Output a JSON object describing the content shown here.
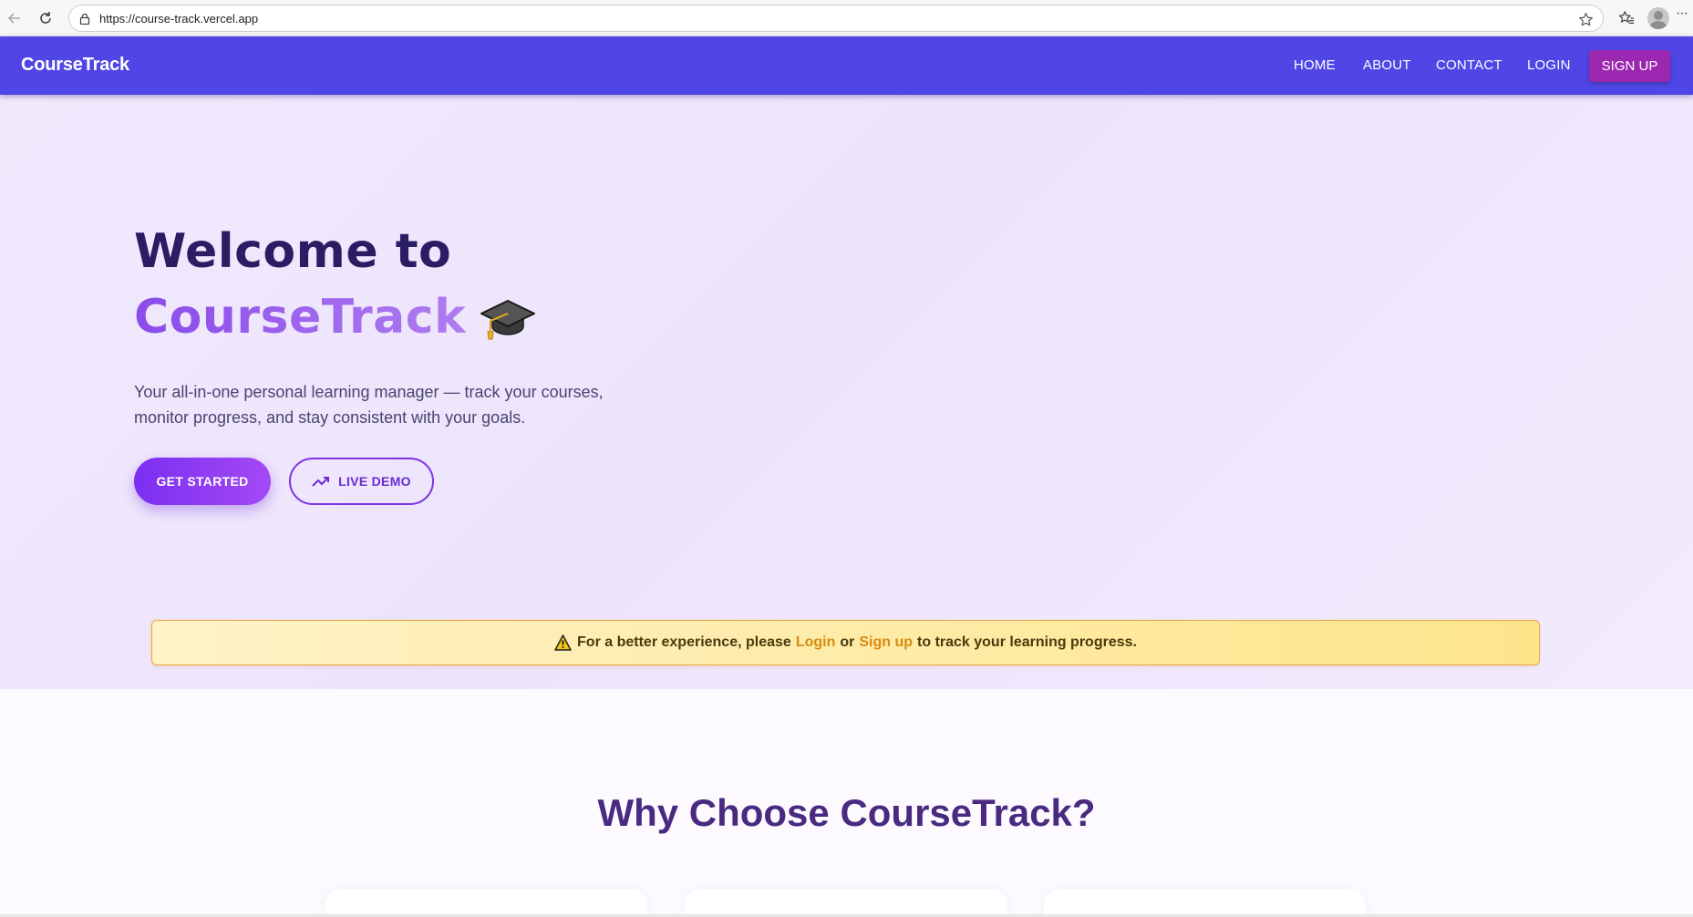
{
  "browser": {
    "url": "https://course-track.vercel.app",
    "more_label": "···"
  },
  "navbar": {
    "brand": "CourseTrack",
    "links": [
      "HOME",
      "ABOUT",
      "CONTACT",
      "LOGIN"
    ],
    "signup_label": "SIGN UP",
    "bg_color": "#4f46e5",
    "signup_color": "#9c27b0"
  },
  "hero": {
    "title_line1": "Welcome to",
    "title_line2": "CourseTrack",
    "title_icon": "graduation-cap-icon",
    "subtitle": "Your all-in-one personal learning manager — track your courses, monitor progress, and stay consistent with your goals.",
    "primary_button": "GET STARTED",
    "secondary_button": "LIVE DEMO",
    "secondary_icon": "trending-up-icon"
  },
  "alert": {
    "icon": "warning-icon",
    "text_before": "For a better experience, please",
    "login_link": "Login",
    "or_text": "or",
    "signup_link": "Sign up",
    "text_after": "to track your learning progress."
  },
  "why": {
    "title": "Why Choose CourseTrack?"
  }
}
